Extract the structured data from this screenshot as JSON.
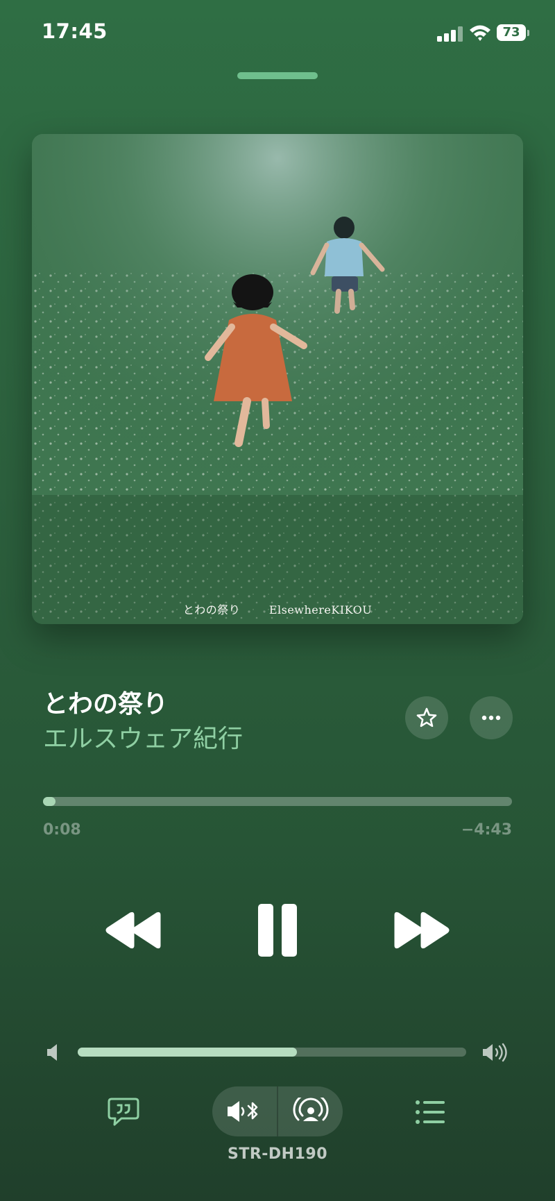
{
  "status_bar": {
    "time": "17:45",
    "battery": "73"
  },
  "artwork": {
    "caption_title": "とわの祭り",
    "caption_artist": "ElsewhereKIKOU"
  },
  "track": {
    "title": "とわの祭り",
    "artist": "エルスウェア紀行"
  },
  "playback": {
    "elapsed": "0:08",
    "remaining": "−4:43",
    "progress_fraction": 0.027
  },
  "volume": {
    "level_fraction": 0.565
  },
  "output": {
    "device_name": "STR-DH190"
  },
  "colors": {
    "accent": "#8fcfa3",
    "background_top": "#2f6e44",
    "background_bottom": "#203f2b"
  },
  "icons": [
    "signal-icon",
    "wifi-icon",
    "battery-icon",
    "star-icon",
    "more-icon",
    "rewind-icon",
    "pause-icon",
    "fast-forward-icon",
    "volume-low-icon",
    "volume-high-icon",
    "lyrics-icon",
    "bluetooth-speaker-icon",
    "airplay-icon",
    "queue-icon"
  ]
}
